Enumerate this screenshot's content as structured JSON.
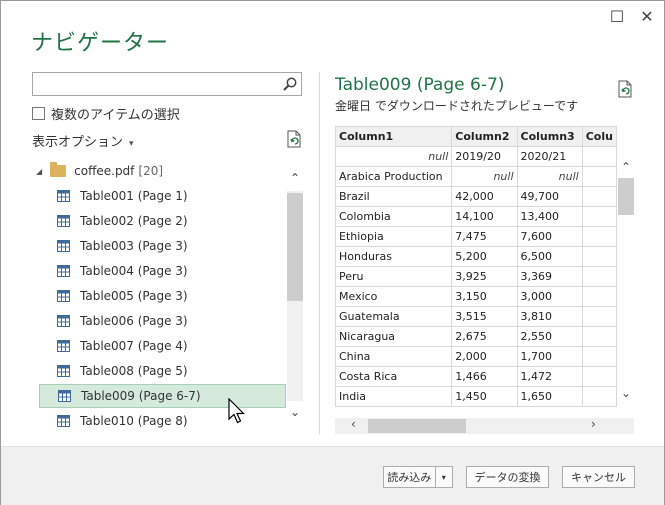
{
  "window": {
    "title": "ナビゲーター",
    "maximize_glyph": "☐",
    "close_glyph": "✕"
  },
  "left": {
    "search": {
      "value": "",
      "placeholder": ""
    },
    "multi_select_label": "複数のアイテムの選択",
    "display_options_label": "表示オプション",
    "display_options_arrow": "▾",
    "tree": {
      "root_name": "coffee.pdf",
      "root_count": "[20]",
      "items": [
        {
          "label": "Table001 (Page 1)"
        },
        {
          "label": "Table002 (Page 2)"
        },
        {
          "label": "Table003 (Page 3)"
        },
        {
          "label": "Table004 (Page 3)"
        },
        {
          "label": "Table005 (Page 3)"
        },
        {
          "label": "Table006 (Page 3)"
        },
        {
          "label": "Table007 (Page 4)"
        },
        {
          "label": "Table008 (Page 5)"
        },
        {
          "label": "Table009 (Page 6-7)",
          "selected": true
        },
        {
          "label": "Table010 (Page 8)"
        }
      ]
    }
  },
  "preview": {
    "title": "Table009 (Page 6-7)",
    "subtitle": "金曜日 でダウンロードされたプレビューです",
    "columns": [
      "Column1",
      "Column2",
      "Column3",
      "Colu"
    ],
    "rows": [
      [
        "null",
        "2019/20",
        "2020/21",
        ""
      ],
      [
        "Arabica Production",
        "null",
        "null",
        ""
      ],
      [
        "Brazil",
        "42,000",
        "49,700",
        ""
      ],
      [
        "Colombia",
        "14,100",
        "13,400",
        ""
      ],
      [
        "Ethiopia",
        "7,475",
        "7,600",
        ""
      ],
      [
        "Honduras",
        "5,200",
        "6,500",
        ""
      ],
      [
        "Peru",
        "3,925",
        "3,369",
        ""
      ],
      [
        "Mexico",
        "3,150",
        "3,000",
        ""
      ],
      [
        "Guatemala",
        "3,515",
        "3,810",
        ""
      ],
      [
        "Nicaragua",
        "2,675",
        "2,550",
        ""
      ],
      [
        "China",
        "2,000",
        "1,700",
        ""
      ],
      [
        "Costa Rica",
        "1,466",
        "1,472",
        ""
      ],
      [
        "India",
        "1,450",
        "1,650",
        ""
      ]
    ]
  },
  "footer": {
    "load_label": "読み込み",
    "load_dropdown_arrow": "▾",
    "transform_label": "データの変換",
    "cancel_label": "キャンセル"
  },
  "colors": {
    "accent": "#217346",
    "selected_bg": "#d5eadc"
  }
}
